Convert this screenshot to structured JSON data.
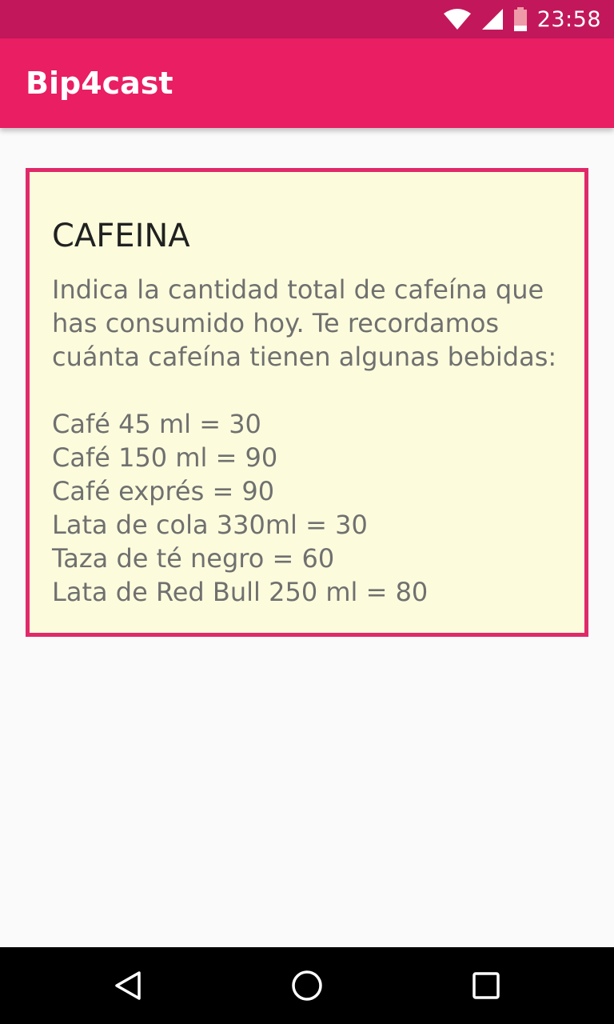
{
  "status_bar": {
    "time": "23:58",
    "icons": [
      "wifi-icon",
      "signal-icon",
      "battery-icon"
    ]
  },
  "app_bar": {
    "title": "Bip4cast"
  },
  "card": {
    "title": "CAFEINA",
    "description": "Indica la cantidad total de cafeína que has consumido hoy. Te recordamos cuánta cafeína tienen algunas bebidas:",
    "drinks": [
      "Café 45 ml = 30",
      "Café 150 ml = 90",
      "Café exprés = 90",
      "Lata de cola 330ml = 30",
      "Taza de té negro = 60",
      "Lata de Red Bull 250 ml = 80"
    ]
  },
  "nav_bar": {
    "buttons": [
      "back-icon",
      "home-icon",
      "recents-icon"
    ]
  },
  "colors": {
    "status_bar": "#c2185b",
    "app_bar": "#e91e63",
    "card_border": "#e0296a",
    "card_background": "#fcfcdd"
  }
}
